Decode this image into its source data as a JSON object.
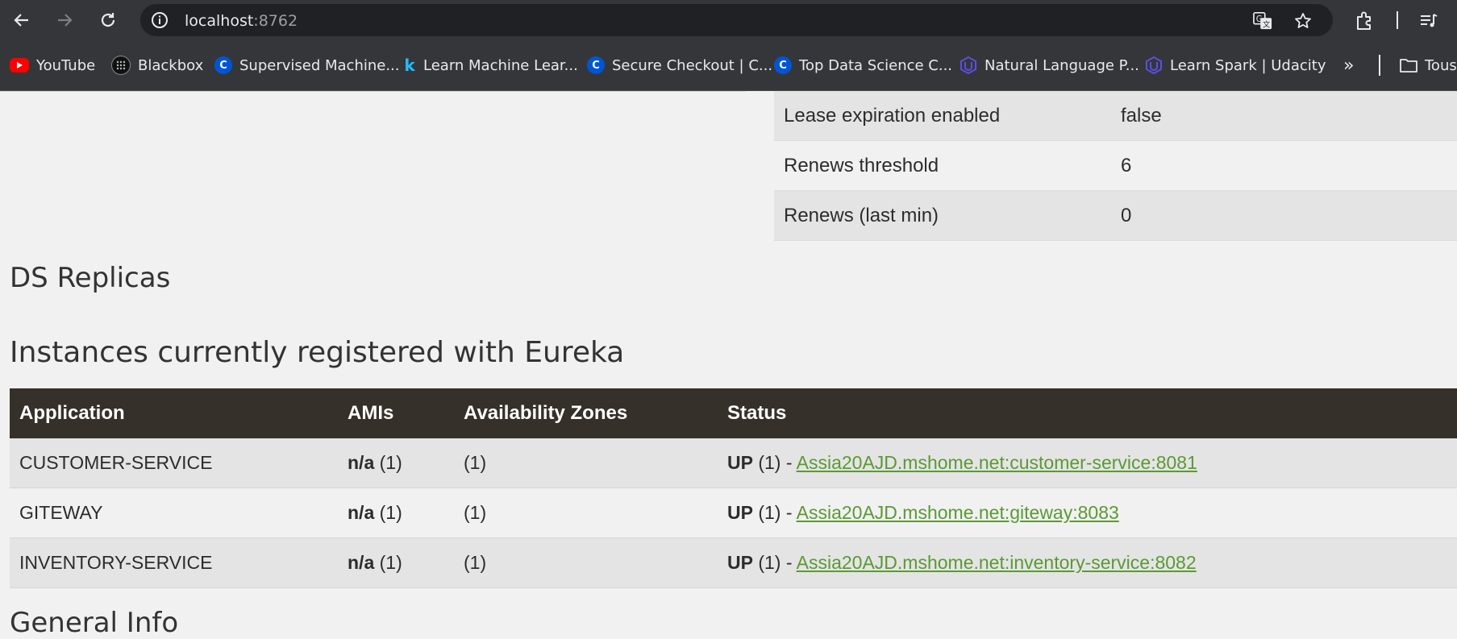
{
  "browser": {
    "url_host": "localhost",
    "url_port": ":8762",
    "bookmarks": [
      {
        "label": "YouTube",
        "icon": "youtube-icon"
      },
      {
        "label": "Blackbox",
        "icon": "blackbox-icon"
      },
      {
        "label": "Supervised Machine...",
        "icon": "coursera-icon"
      },
      {
        "label": "Learn Machine Lear...",
        "icon": "kaggle-icon"
      },
      {
        "label": "Secure Checkout | C...",
        "icon": "coursera-icon"
      },
      {
        "label": "Top Data Science C...",
        "icon": "coursera-icon"
      },
      {
        "label": "Natural Language P...",
        "icon": "udacity-icon"
      },
      {
        "label": "Learn Spark | Udacity",
        "icon": "udacity-icon"
      }
    ],
    "overflow_label": "»",
    "folder_label": "Tous"
  },
  "lease": {
    "rows": [
      {
        "key": "Lease expiration enabled",
        "value": "false"
      },
      {
        "key": "Renews threshold",
        "value": "6"
      },
      {
        "key": "Renews (last min)",
        "value": "0"
      }
    ]
  },
  "sections": {
    "ds_replicas": "DS Replicas",
    "instances": "Instances currently registered with Eureka",
    "general_info": "General Info"
  },
  "instances": {
    "headers": [
      "Application",
      "AMIs",
      "Availability Zones",
      "Status"
    ],
    "rows": [
      {
        "app": "CUSTOMER-SERVICE",
        "ami": "n/a",
        "ami_count": " (1)",
        "zones": "(1)",
        "status": "UP",
        "status_count": " (1) - ",
        "link": "Assia20AJD.mshome.net:customer-service:8081"
      },
      {
        "app": "GITEWAY",
        "ami": "n/a",
        "ami_count": " (1)",
        "zones": "(1)",
        "status": "UP",
        "status_count": " (1) - ",
        "link": "Assia20AJD.mshome.net:giteway:8083"
      },
      {
        "app": "INVENTORY-SERVICE",
        "ami": "n/a",
        "ami_count": " (1)",
        "zones": "(1)",
        "status": "UP",
        "status_count": " (1) - ",
        "link": "Assia20AJD.mshome.net:inventory-service:8082"
      }
    ]
  },
  "colors": {
    "header_bg": "#353029",
    "link": "#5a9a33",
    "chrome_bg": "#35363a"
  }
}
